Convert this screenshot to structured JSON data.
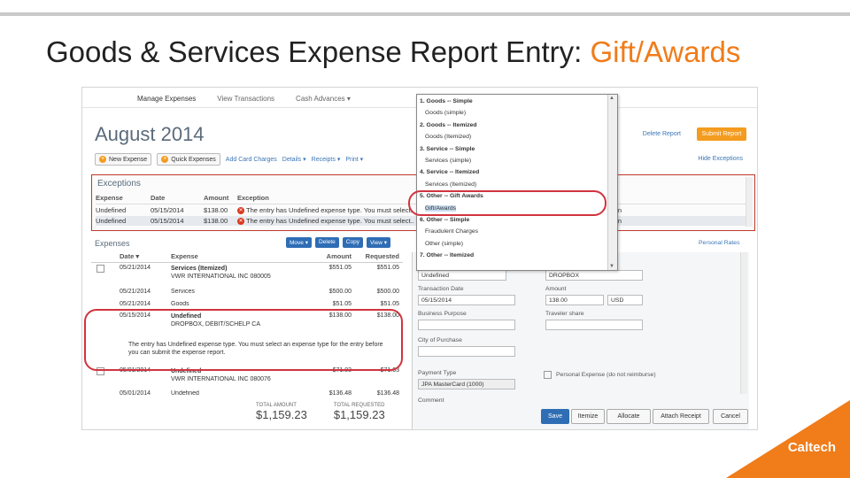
{
  "slide": {
    "title_main": "Goods & Services Expense Report Entry:",
    "title_accent": "Gift/Awards",
    "logo": "Caltech"
  },
  "app": {
    "nav": [
      "Manage Expenses",
      "View Transactions",
      "Cash Advances ▾"
    ],
    "month": "August 2014",
    "delete_report": "Delete Report",
    "submit_report": "Submit Report",
    "toolbar": {
      "new_expense": "New Expense",
      "quick_expenses": "Quick Expenses",
      "add_card_charges": "Add Card Charges",
      "details": "Details ▾",
      "receipts": "Receipts ▾",
      "print": "Print ▾"
    },
    "hide_exceptions": "Hide Exceptions",
    "exceptions": {
      "title": "Exceptions",
      "headers": [
        "Expense",
        "Date",
        "Amount",
        "Exception"
      ],
      "rows": [
        {
          "expense": "Undefined",
          "date": "05/15/2014",
          "amount": "$138.00",
          "message": "The entry has Undefined expense type. You must select..."
        },
        {
          "expense": "Undefined",
          "date": "05/15/2014",
          "amount": "$138.00",
          "message": "The entry has Undefined expense type. You must select..."
        }
      ],
      "right_tail": [
        "son",
        "son"
      ]
    },
    "expenses": {
      "title": "Expenses",
      "actions": [
        "Move ▾",
        "Delete",
        "Copy",
        "View ▾"
      ],
      "headers": [
        "Date ▾",
        "Expense",
        "Amount",
        "Requested"
      ],
      "rows": [
        {
          "date": "05/21/2014",
          "expense": "Services (Itemized)",
          "sub": "VWR INTERNATIONAL INC 080005",
          "amount": "$551.05",
          "requested": "$551.05"
        },
        {
          "date": "05/21/2014",
          "expense": "Services",
          "sub": "",
          "amount": "$500.00",
          "requested": "$500.00"
        },
        {
          "date": "05/21/2014",
          "expense": "Goods",
          "sub": "",
          "amount": "$51.05",
          "requested": "$51.05"
        },
        {
          "date": "05/15/2014",
          "expense": "Undefined",
          "sub": "DROPBOX, DEBIT/SCHELP CA",
          "amount": "$138.00",
          "requested": "$138.00"
        },
        {
          "date": "05/01/2014",
          "expense": "Undefined",
          "sub": "VWR INTERNATIONAL INC 080076",
          "amount": "$71.03",
          "requested": "$71.03"
        },
        {
          "date": "05/01/2014",
          "expense": "Undefined",
          "sub": "",
          "amount": "$136.48",
          "requested": "$136.48"
        }
      ],
      "exception_note": "The entry has Undefined expense type. You must select an expense type for the entry before you can submit the expense report.",
      "total_amount_label": "TOTAL AMOUNT",
      "total_amount": "$1,159.23",
      "total_requested_label": "TOTAL REQUESTED",
      "total_requested": "$1,159.23"
    },
    "expense_type_dropdown": [
      {
        "label": "1. Goods -- Simple",
        "group": true
      },
      {
        "label": "Goods (simple)",
        "group": false
      },
      {
        "label": "2. Goods -- Itemized",
        "group": true
      },
      {
        "label": "Goods (Itemized)",
        "group": false
      },
      {
        "label": "3. Service -- Simple",
        "group": true
      },
      {
        "label": "Services (simple)",
        "group": false
      },
      {
        "label": "4. Service -- Itemized",
        "group": true
      },
      {
        "label": "Services (Itemized)",
        "group": false
      },
      {
        "label": "5. Other -- Gift Awards",
        "group": true
      },
      {
        "label": "Gift/Awards",
        "group": false
      },
      {
        "label": "6. Other -- Simple",
        "group": true
      },
      {
        "label": "Fraudulent Charges",
        "group": false
      },
      {
        "label": "Other (simple)",
        "group": false
      },
      {
        "label": "7. Other -- Itemized",
        "group": true
      }
    ],
    "form": {
      "expense_type_value": "Undefined",
      "vendor_value": "DROPBOX",
      "transaction_date_label": "Transaction Date",
      "transaction_date_value": "05/15/2014",
      "amount_label": "Amount",
      "amount_value": "138.00",
      "currency_value": "USD",
      "business_purpose_label": "Business Purpose",
      "traveler_share_label": "Traveler share",
      "city_label": "City of Purchase",
      "payment_type_label": "Payment Type",
      "payment_type_value": "JPA MasterCard (1000)",
      "personal_expense_label": "Personal Expense (do not reimburse)",
      "comment_label": "Comment",
      "buttons": [
        "Save",
        "Itemize",
        "Allocate",
        "Attach Receipt",
        "Cancel"
      ]
    },
    "panel_link": "Personal Rates"
  }
}
